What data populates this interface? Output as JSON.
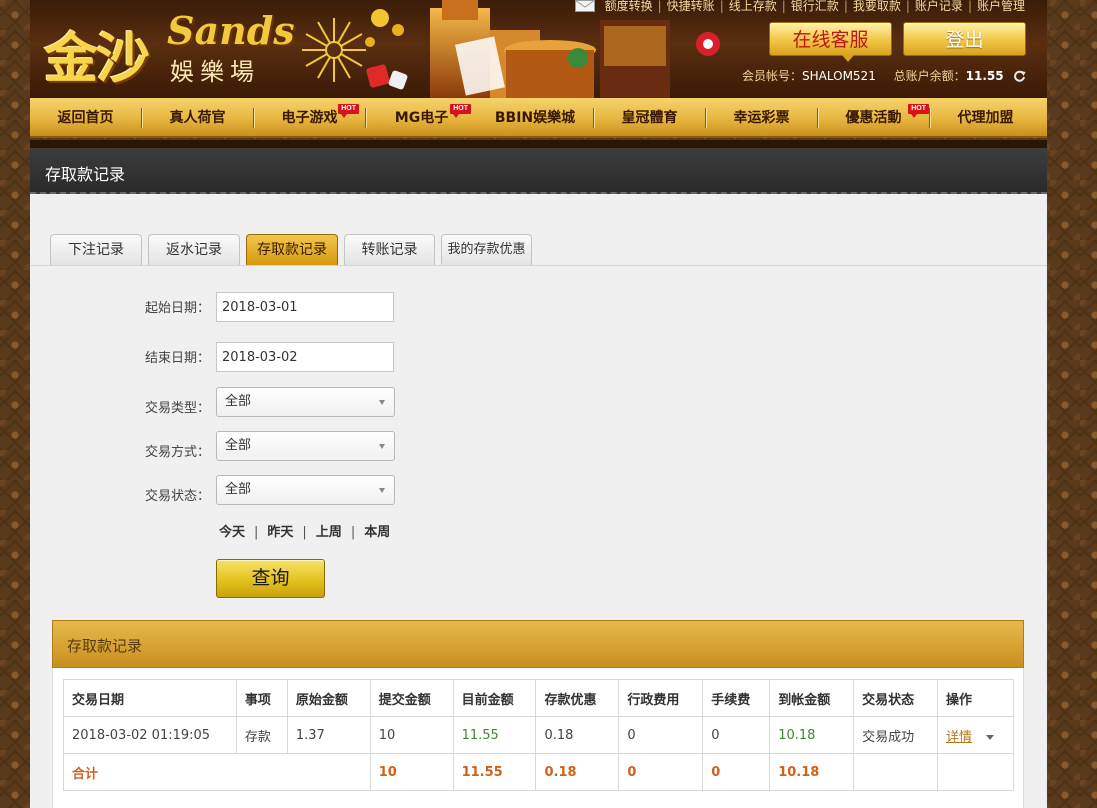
{
  "header": {
    "logo_cn": "金沙",
    "logo_en": "Sands",
    "logo_sub": "娛樂場",
    "top_links": [
      "额度转换",
      "快捷转账",
      "线上存款",
      "银行汇款",
      "我要取款",
      "账户记录",
      "账户管理"
    ],
    "service_button": "在线客服",
    "logout_button": "登出",
    "member_label": "会员帐号：",
    "member_id": "SHALOM521",
    "balance_label": "总账户余额：",
    "balance": "11.55"
  },
  "nav": {
    "items": [
      {
        "label": "返回首页",
        "hot": false
      },
      {
        "label": "真人荷官",
        "hot": false
      },
      {
        "label": "电子游戏",
        "hot": true
      },
      {
        "label": "MG电子",
        "hot": true
      },
      {
        "label": "BBIN娱樂城",
        "hot": false
      },
      {
        "label": "皇冠體育",
        "hot": false
      },
      {
        "label": "幸运彩票",
        "hot": false
      },
      {
        "label": "優惠活動",
        "hot": true
      },
      {
        "label": "代理加盟",
        "hot": false
      }
    ],
    "hot_text": "HOT"
  },
  "page": {
    "title": "存取款记录"
  },
  "tabs": [
    {
      "label": "下注记录",
      "active": false
    },
    {
      "label": "返水记录",
      "active": false
    },
    {
      "label": "存取款记录",
      "active": true
    },
    {
      "label": "转账记录",
      "active": false
    },
    {
      "label": "我的存款优惠",
      "active": false
    }
  ],
  "form": {
    "start_label": "起始日期：",
    "start_value": "2018-03-01",
    "end_label": "结束日期：",
    "end_value": "2018-03-02",
    "type_label": "交易类型：",
    "type_value": "全部",
    "method_label": "交易方式：",
    "method_value": "全部",
    "status_label": "交易状态：",
    "status_value": "全部",
    "quick_dates": [
      "今天",
      "昨天",
      "上周",
      "本周"
    ],
    "query_button": "查询"
  },
  "records": {
    "title": "存取款记录",
    "columns": [
      "交易日期",
      "事项",
      "原始金额",
      "提交金额",
      "目前金额",
      "存款优惠",
      "行政费用",
      "手续费",
      "到帐金额",
      "交易状态",
      "操作"
    ],
    "rows": [
      {
        "date": "2018-03-02 01:19:05",
        "item": "存款",
        "original": "1.37",
        "submitted": "10",
        "current": "11.55",
        "bonus": "0.18",
        "admin_fee": "0",
        "fee": "0",
        "received": "10.18",
        "status": "交易成功",
        "action": "详情"
      }
    ],
    "total": {
      "label": "合计",
      "submitted": "10",
      "current": "11.55",
      "bonus": "0.18",
      "admin_fee": "0",
      "fee": "0",
      "received": "10.18"
    }
  },
  "colors": {
    "gold": "#e7b640",
    "dark_brown": "#3a1c08",
    "total_orange": "#d2601a",
    "green_value": "#3b8c2a",
    "service_red": "#c0161a"
  }
}
